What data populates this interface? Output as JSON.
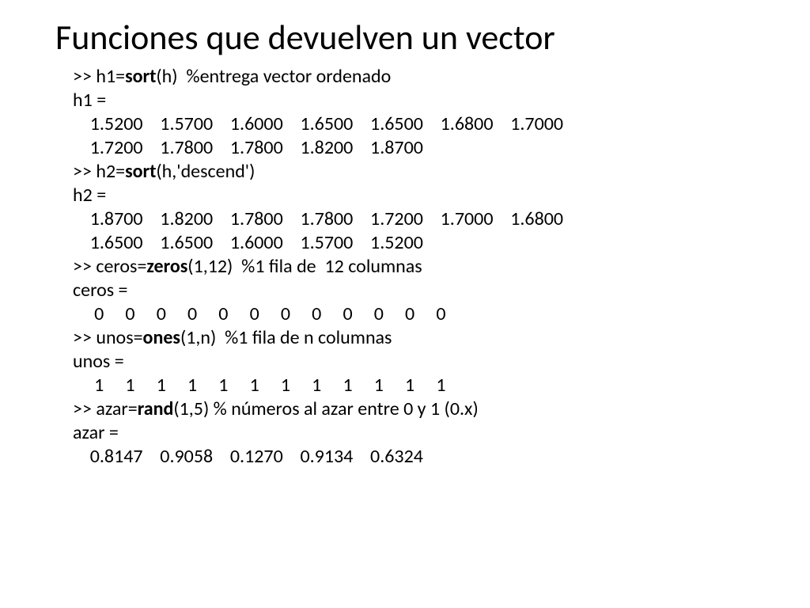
{
  "title": "Funciones que devuelven un vector",
  "lines": [
    [
      ">> h1=",
      {
        "b": "sort"
      },
      "(h)  %entrega vector ordenado"
    ],
    [
      "h1 ="
    ],
    [
      "    1.5200    1.5700    1.6000    1.6500    1.6500    1.6800    1.7000"
    ],
    [
      "    1.7200    1.7800    1.7800    1.8200    1.8700"
    ],
    [
      ">> h2=",
      {
        "b": "sort"
      },
      "(h,'descend')"
    ],
    [
      "h2 ="
    ],
    [
      "    1.8700    1.8200    1.7800    1.7800    1.7200    1.7000    1.6800"
    ],
    [
      "    1.6500    1.6500    1.6000    1.5700    1.5200"
    ],
    [
      ">> ceros=",
      {
        "b": "zeros"
      },
      "(1,12)  %1 fila de  12 columnas"
    ],
    [
      "ceros ="
    ],
    [
      "     0     0     0     0     0     0     0     0     0     0     0     0"
    ],
    [
      ">> unos=",
      {
        "b": "ones"
      },
      "(1,n)  %1 fila de n columnas"
    ],
    [
      "unos ="
    ],
    [
      "     1     1     1     1     1     1     1     1     1     1     1     1"
    ],
    [
      ">> azar=",
      {
        "b": "rand"
      },
      "(1,5) % números al azar entre 0 y 1 (0.x)"
    ],
    [
      "azar ="
    ],
    [
      "    0.8147    0.9058    0.1270    0.9134    0.6324"
    ]
  ]
}
